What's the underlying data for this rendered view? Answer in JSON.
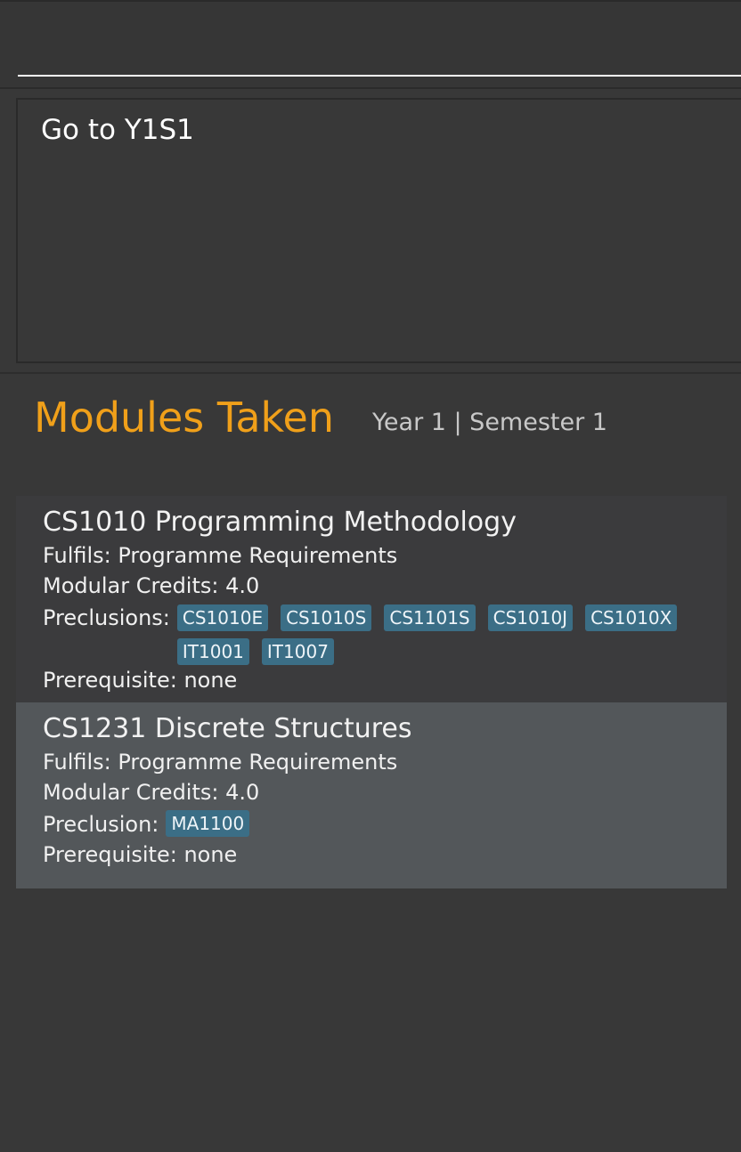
{
  "command_box": {
    "value": "",
    "placeholder": ""
  },
  "result_display": {
    "text": "Go to Y1S1"
  },
  "header": {
    "title": "Modules Taken",
    "subtitle": "Year 1 | Semester 1"
  },
  "modules": [
    {
      "title": "CS1010 Programming Methodology",
      "fulfils": "Fulfils: Programme Requirements",
      "credits": "Modular Credits: 4.0",
      "preclusion_label": "Preclusions:",
      "preclusions": [
        "CS1010E",
        "CS1010S",
        "CS1101S",
        "CS1010J",
        "CS1010X",
        "IT1001",
        "IT1007"
      ],
      "prerequisite": "Prerequisite: none"
    },
    {
      "title": "CS1231 Discrete Structures",
      "fulfils": "Fulfils: Programme Requirements",
      "credits": "Modular Credits: 4.0",
      "preclusion_label": "Preclusion:",
      "preclusions": [
        "MA1100"
      ],
      "prerequisite": "Prerequisite: none"
    }
  ],
  "colors": {
    "background": "#383838",
    "title_accent": "#f0a01a",
    "tag_background": "#3b6e86",
    "card_1": "#3b3b3d",
    "card_2_selected": "#53575a"
  }
}
